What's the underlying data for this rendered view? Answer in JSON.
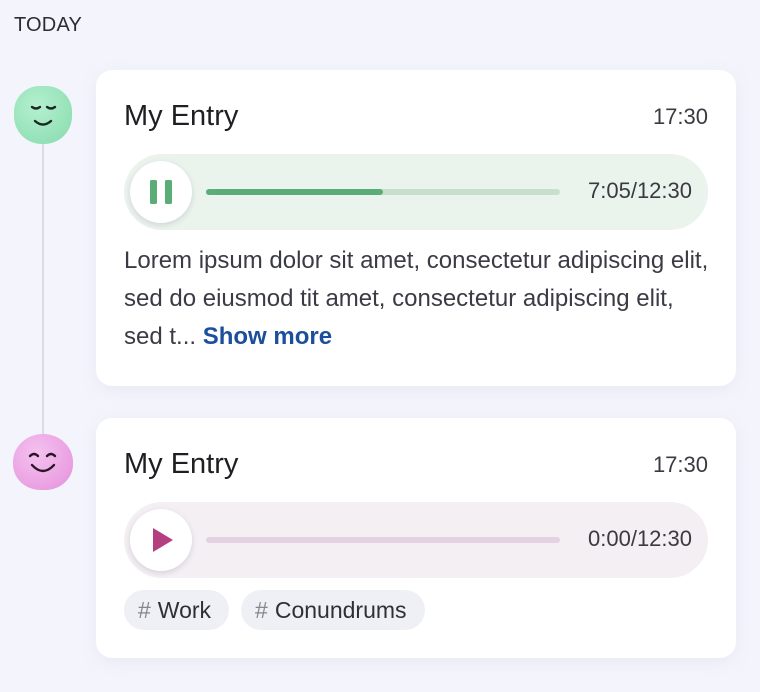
{
  "section": {
    "label": "TODAY"
  },
  "entries": [
    {
      "title": "My Entry",
      "time": "17:30",
      "mood": "calm-smile-green",
      "player": {
        "state": "playing",
        "icon": "pause-icon",
        "duration": "7:05/12:30",
        "progress": 0.5
      },
      "text_before": "Lorem ipsum dolor sit amet, consectetur adipiscing elit, sed do eiusmod tit amet, consectetur adipiscing elit, sed t... ",
      "show_more": "Show more"
    },
    {
      "title": "My Entry",
      "time": "17:30",
      "mood": "content-smile-pink",
      "player": {
        "state": "paused",
        "icon": "play-icon",
        "duration": "0:00/12:30",
        "progress": 0
      },
      "tags": [
        {
          "hash": "#",
          "label": "Work"
        },
        {
          "hash": "#",
          "label": "Conundrums"
        }
      ]
    }
  ],
  "colors": {
    "accent_green": "#5aad77",
    "accent_magenta": "#b5407f",
    "link": "#1b4f9c"
  }
}
